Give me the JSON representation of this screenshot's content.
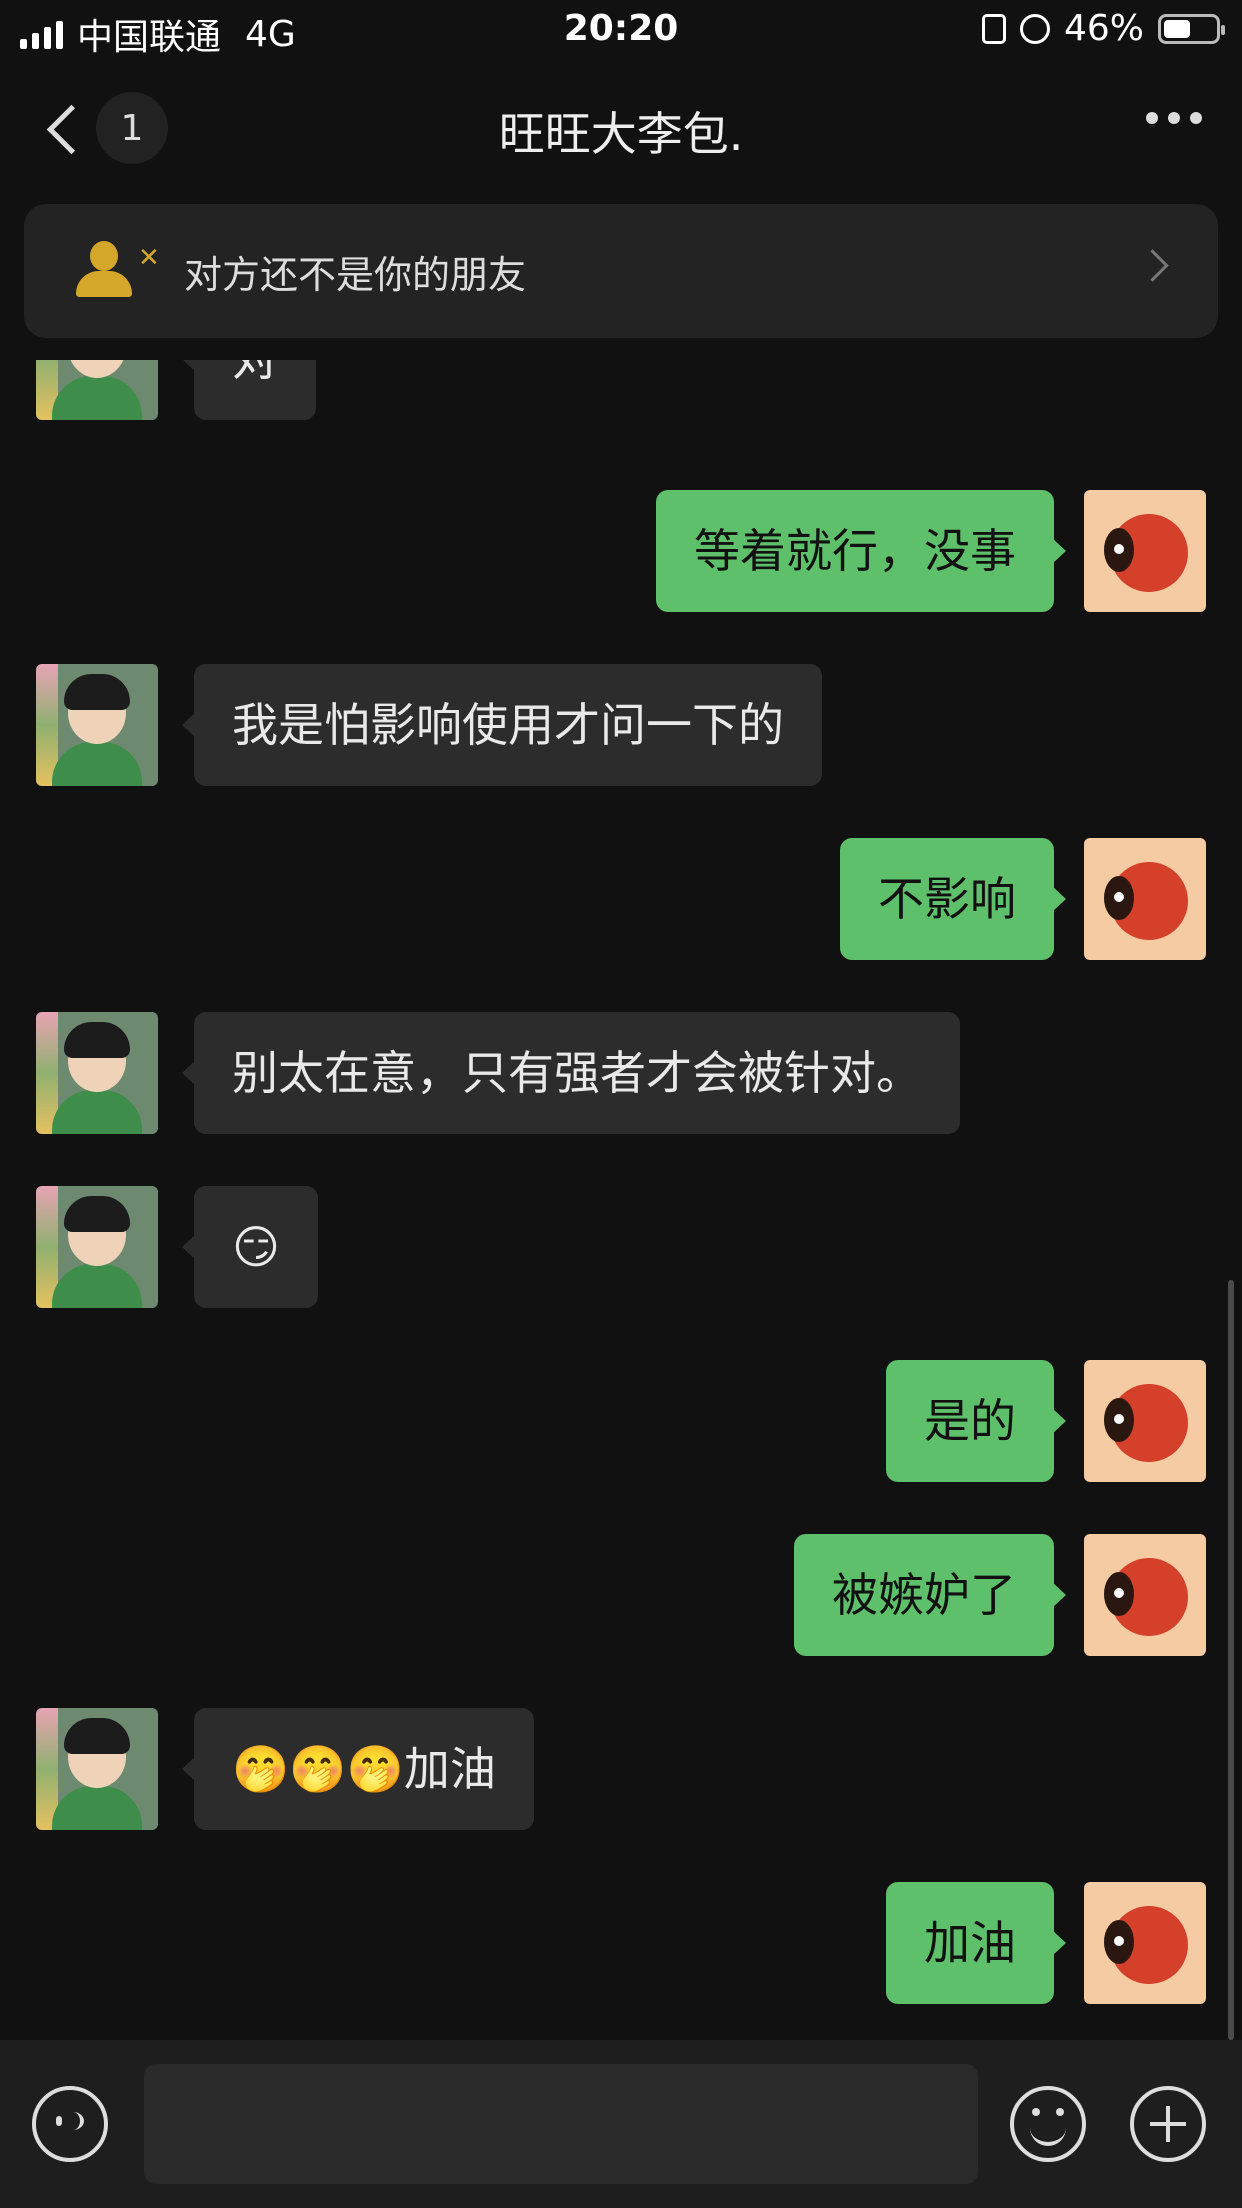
{
  "status_bar": {
    "carrier": "中国联通",
    "network": "4G",
    "time": "20:20",
    "battery": "46%",
    "battery_level": 0.46
  },
  "nav": {
    "unread_count": "1",
    "title": "旺旺大李包."
  },
  "notice": {
    "text": "对方还不是你的朋友"
  },
  "messages": [
    {
      "side": "in",
      "text": "对"
    },
    {
      "side": "out",
      "text": "等着就行，没事"
    },
    {
      "side": "in",
      "text": "我是怕影响使用才问一下的"
    },
    {
      "side": "out",
      "text": "不影响"
    },
    {
      "side": "in",
      "text": "别太在意，只有强者才会被针对。"
    },
    {
      "side": "in",
      "text": "😏"
    },
    {
      "side": "out",
      "text": "是的"
    },
    {
      "side": "out",
      "text": "被嫉妒了"
    },
    {
      "side": "in",
      "text": "🤭🤭🤭加油"
    },
    {
      "side": "out",
      "text": "加油"
    }
  ],
  "colors": {
    "background": "#111111",
    "outgoing_bubble": "#5ec06a",
    "incoming_bubble": "#2c2c2c",
    "notice_icon": "#d4a62a"
  },
  "icons": {
    "back": "chevron-left-icon",
    "more": "ellipsis-icon",
    "notice": "user-x-icon",
    "voice": "voice-icon",
    "emoji": "emoji-icon",
    "plus": "plus-icon"
  }
}
